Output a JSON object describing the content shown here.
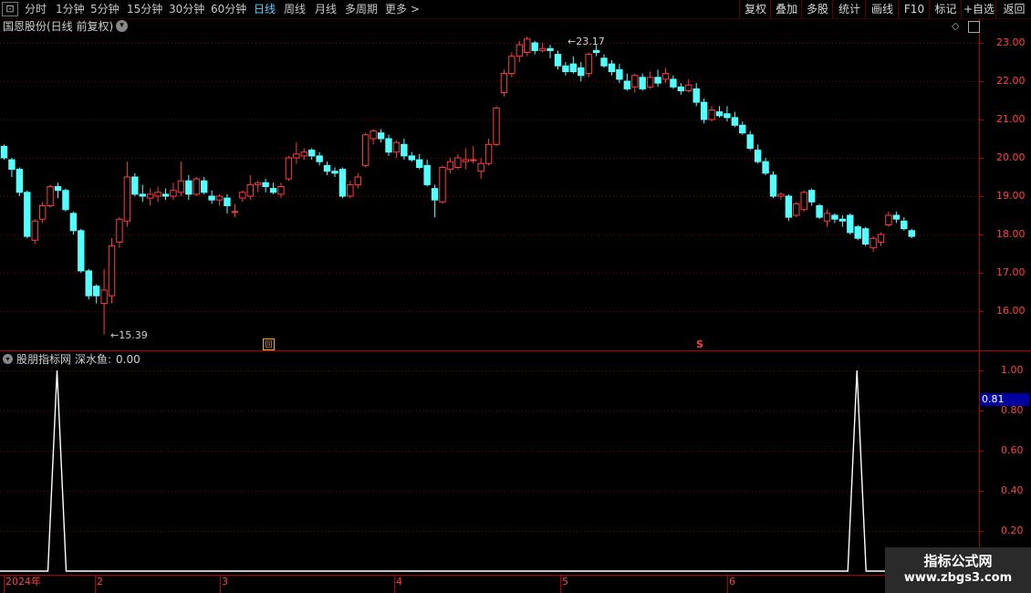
{
  "toolbar": {
    "menu_glyph": "⊡",
    "periods": [
      "分时",
      "1分钟",
      "5分钟",
      "15分钟",
      "30分钟",
      "60分钟",
      "日线",
      "周线",
      "月线",
      "多周期",
      "更多 >"
    ],
    "active_period": "日线",
    "right_buttons": [
      "复权",
      "叠加",
      "多股",
      "统计",
      "画线",
      "F10",
      "标记",
      "+自选",
      "返回"
    ]
  },
  "main_panel": {
    "title": "国恩股份(日线 前复权)",
    "high_marker": "23.17",
    "low_marker": "15.39",
    "price_labels": [
      "23.00",
      "22.00",
      "21.00",
      "20.00",
      "19.00",
      "18.00",
      "17.00",
      "16.00"
    ],
    "event_marker": "回",
    "event_marker_s": "S"
  },
  "indicator_panel": {
    "title": "股朋指标网",
    "indicator_name": "深水鱼:",
    "indicator_value": "0.00",
    "cursor_value": "0.81",
    "y_labels": [
      "1.00",
      "0.80",
      "0.60",
      "0.40",
      "0.20"
    ]
  },
  "time_axis": {
    "labels": [
      "2024年",
      "2",
      "3",
      "4",
      "5",
      "6"
    ]
  },
  "watermark": {
    "title": "指标公式网",
    "url": "www.zbgs3.com"
  },
  "colors": {
    "up": "#ff3c3c",
    "down": "#54ffff",
    "grid": "#8b0000",
    "axis": "#b00000",
    "indicator_line": "#ffffff"
  },
  "chart_data": [
    {
      "type": "candlestick",
      "title": "国恩股份(日线 前复权)",
      "ylim": [
        15.0,
        23.5
      ],
      "annotations": {
        "high": 23.17,
        "low": 15.39
      },
      "ohlc": [
        [
          20.3,
          20.35,
          19.95,
          20.0
        ],
        [
          19.95,
          20.0,
          19.5,
          19.7
        ],
        [
          19.7,
          19.75,
          19.0,
          19.1
        ],
        [
          19.1,
          19.15,
          17.9,
          17.95
        ],
        [
          17.85,
          18.4,
          17.75,
          18.35
        ],
        [
          18.4,
          18.85,
          18.3,
          18.75
        ],
        [
          18.75,
          19.3,
          18.7,
          19.25
        ],
        [
          19.25,
          19.35,
          18.95,
          19.15
        ],
        [
          19.15,
          19.2,
          18.6,
          18.65
        ],
        [
          18.55,
          18.6,
          18.0,
          18.1
        ],
        [
          18.1,
          18.15,
          17.0,
          17.05
        ],
        [
          17.05,
          17.1,
          16.3,
          16.4
        ],
        [
          16.65,
          16.7,
          16.2,
          16.4
        ],
        [
          16.2,
          17.1,
          15.39,
          16.55
        ],
        [
          16.4,
          17.9,
          16.2,
          17.7
        ],
        [
          17.8,
          18.45,
          17.65,
          18.4
        ],
        [
          18.35,
          19.9,
          18.2,
          19.5
        ],
        [
          19.5,
          19.6,
          19.0,
          19.05
        ],
        [
          19.05,
          19.3,
          18.85,
          19.0
        ],
        [
          18.95,
          19.2,
          18.75,
          19.05
        ],
        [
          19.0,
          19.25,
          18.85,
          19.1
        ],
        [
          19.05,
          19.2,
          18.9,
          19.0
        ],
        [
          19.0,
          19.35,
          18.9,
          19.15
        ],
        [
          19.1,
          19.9,
          19.0,
          19.4
        ],
        [
          19.4,
          19.55,
          18.9,
          19.05
        ],
        [
          19.05,
          19.5,
          19.0,
          19.45
        ],
        [
          19.4,
          19.5,
          19.05,
          19.1
        ],
        [
          19.0,
          19.15,
          18.8,
          18.9
        ],
        [
          18.9,
          19.05,
          18.75,
          19.0
        ],
        [
          18.95,
          19.05,
          18.55,
          18.75
        ],
        [
          18.6,
          18.8,
          18.45,
          18.6
        ],
        [
          18.95,
          19.15,
          18.85,
          19.1
        ],
        [
          19.0,
          19.55,
          18.9,
          19.3
        ],
        [
          19.3,
          19.4,
          19.1,
          19.35
        ],
        [
          19.35,
          19.45,
          19.1,
          19.25
        ],
        [
          19.2,
          19.35,
          19.05,
          19.1
        ],
        [
          19.05,
          19.35,
          18.95,
          19.25
        ],
        [
          19.45,
          20.05,
          19.4,
          20.0
        ],
        [
          20.0,
          20.4,
          19.85,
          20.1
        ],
        [
          20.05,
          20.25,
          19.95,
          20.15
        ],
        [
          20.2,
          20.25,
          19.95,
          20.05
        ],
        [
          20.05,
          20.15,
          19.8,
          19.9
        ],
        [
          19.8,
          19.9,
          19.55,
          19.65
        ],
        [
          19.65,
          19.75,
          19.5,
          19.6
        ],
        [
          19.7,
          19.75,
          18.95,
          19.0
        ],
        [
          19.0,
          19.4,
          18.95,
          19.3
        ],
        [
          19.3,
          19.6,
          19.2,
          19.5
        ],
        [
          19.8,
          20.65,
          19.75,
          20.6
        ],
        [
          20.5,
          20.75,
          20.35,
          20.7
        ],
        [
          20.65,
          20.75,
          20.4,
          20.5
        ],
        [
          20.5,
          20.6,
          20.05,
          20.15
        ],
        [
          20.15,
          20.45,
          20.0,
          20.4
        ],
        [
          20.35,
          20.5,
          19.95,
          20.05
        ],
        [
          20.05,
          20.15,
          19.9,
          19.95
        ],
        [
          19.95,
          20.1,
          19.7,
          19.75
        ],
        [
          19.8,
          19.95,
          19.25,
          19.3
        ],
        [
          19.2,
          19.3,
          18.45,
          18.9
        ],
        [
          18.85,
          19.8,
          18.8,
          19.75
        ],
        [
          19.7,
          20.0,
          19.6,
          19.9
        ],
        [
          19.75,
          20.1,
          19.7,
          20.0
        ],
        [
          19.9,
          20.25,
          19.7,
          19.95
        ],
        [
          19.95,
          20.3,
          19.85,
          19.95
        ],
        [
          19.65,
          20.0,
          19.45,
          19.85
        ],
        [
          19.85,
          20.5,
          19.8,
          20.35
        ],
        [
          20.35,
          21.35,
          20.3,
          21.3
        ],
        [
          21.7,
          22.3,
          21.6,
          22.2
        ],
        [
          22.2,
          22.75,
          22.1,
          22.65
        ],
        [
          22.65,
          23.05,
          22.5,
          22.95
        ],
        [
          22.75,
          23.17,
          22.65,
          23.1
        ],
        [
          23.0,
          23.05,
          22.7,
          22.8
        ],
        [
          22.8,
          23.0,
          22.75,
          22.85
        ],
        [
          22.85,
          22.95,
          22.6,
          22.8
        ],
        [
          22.7,
          22.8,
          22.3,
          22.4
        ],
        [
          22.4,
          22.5,
          22.15,
          22.25
        ],
        [
          22.45,
          22.65,
          22.2,
          22.25
        ],
        [
          22.35,
          22.5,
          22.0,
          22.15
        ],
        [
          22.2,
          22.75,
          22.1,
          22.7
        ],
        [
          22.8,
          22.95,
          22.65,
          22.75
        ],
        [
          22.6,
          22.7,
          22.35,
          22.4
        ],
        [
          22.45,
          22.55,
          22.15,
          22.25
        ],
        [
          22.3,
          22.45,
          21.95,
          22.05
        ],
        [
          22.0,
          22.2,
          21.75,
          21.8
        ],
        [
          21.85,
          22.2,
          21.7,
          22.15
        ],
        [
          22.1,
          22.2,
          21.75,
          21.8
        ],
        [
          21.85,
          22.25,
          21.8,
          22.1
        ],
        [
          22.1,
          22.3,
          21.85,
          21.95
        ],
        [
          22.05,
          22.35,
          21.95,
          22.2
        ],
        [
          22.05,
          22.15,
          21.8,
          21.85
        ],
        [
          21.85,
          21.95,
          21.65,
          21.75
        ],
        [
          21.75,
          22.05,
          21.7,
          21.9
        ],
        [
          21.8,
          21.95,
          21.35,
          21.45
        ],
        [
          21.45,
          21.55,
          20.9,
          21.0
        ],
        [
          21.0,
          21.35,
          20.95,
          21.25
        ],
        [
          21.2,
          21.35,
          21.05,
          21.1
        ],
        [
          21.15,
          21.35,
          20.95,
          21.05
        ],
        [
          21.05,
          21.2,
          20.8,
          20.85
        ],
        [
          20.85,
          20.95,
          20.6,
          20.65
        ],
        [
          20.6,
          20.7,
          20.2,
          20.25
        ],
        [
          20.2,
          20.35,
          19.85,
          19.9
        ],
        [
          19.9,
          20.0,
          19.55,
          19.6
        ],
        [
          19.55,
          19.65,
          18.95,
          19.0
        ],
        [
          19.0,
          19.1,
          18.9,
          19.05
        ],
        [
          19.0,
          19.05,
          18.35,
          18.45
        ],
        [
          18.5,
          18.85,
          18.45,
          18.8
        ],
        [
          18.65,
          19.15,
          18.6,
          19.1
        ],
        [
          19.15,
          19.2,
          18.75,
          18.85
        ],
        [
          18.75,
          18.8,
          18.4,
          18.45
        ],
        [
          18.35,
          18.65,
          18.2,
          18.55
        ],
        [
          18.5,
          18.55,
          18.3,
          18.4
        ],
        [
          18.4,
          18.5,
          18.2,
          18.35
        ],
        [
          18.5,
          18.55,
          18.0,
          18.05
        ],
        [
          18.2,
          18.25,
          17.85,
          17.9
        ],
        [
          18.15,
          18.2,
          17.7,
          17.75
        ],
        [
          17.65,
          17.95,
          17.55,
          17.9
        ],
        [
          17.8,
          18.05,
          17.7,
          18.0
        ],
        [
          18.25,
          18.6,
          18.2,
          18.5
        ],
        [
          18.5,
          18.6,
          18.3,
          18.4
        ],
        [
          18.35,
          18.45,
          18.1,
          18.15
        ],
        [
          18.1,
          18.15,
          17.9,
          17.95
        ]
      ]
    },
    {
      "type": "line",
      "title": "深水鱼",
      "ylim": [
        0,
        1.0
      ],
      "peaks": [
        {
          "index": 7,
          "value": 1.0
        },
        {
          "index": 111,
          "value": 1.0
        }
      ],
      "baseline": 0.0
    }
  ]
}
